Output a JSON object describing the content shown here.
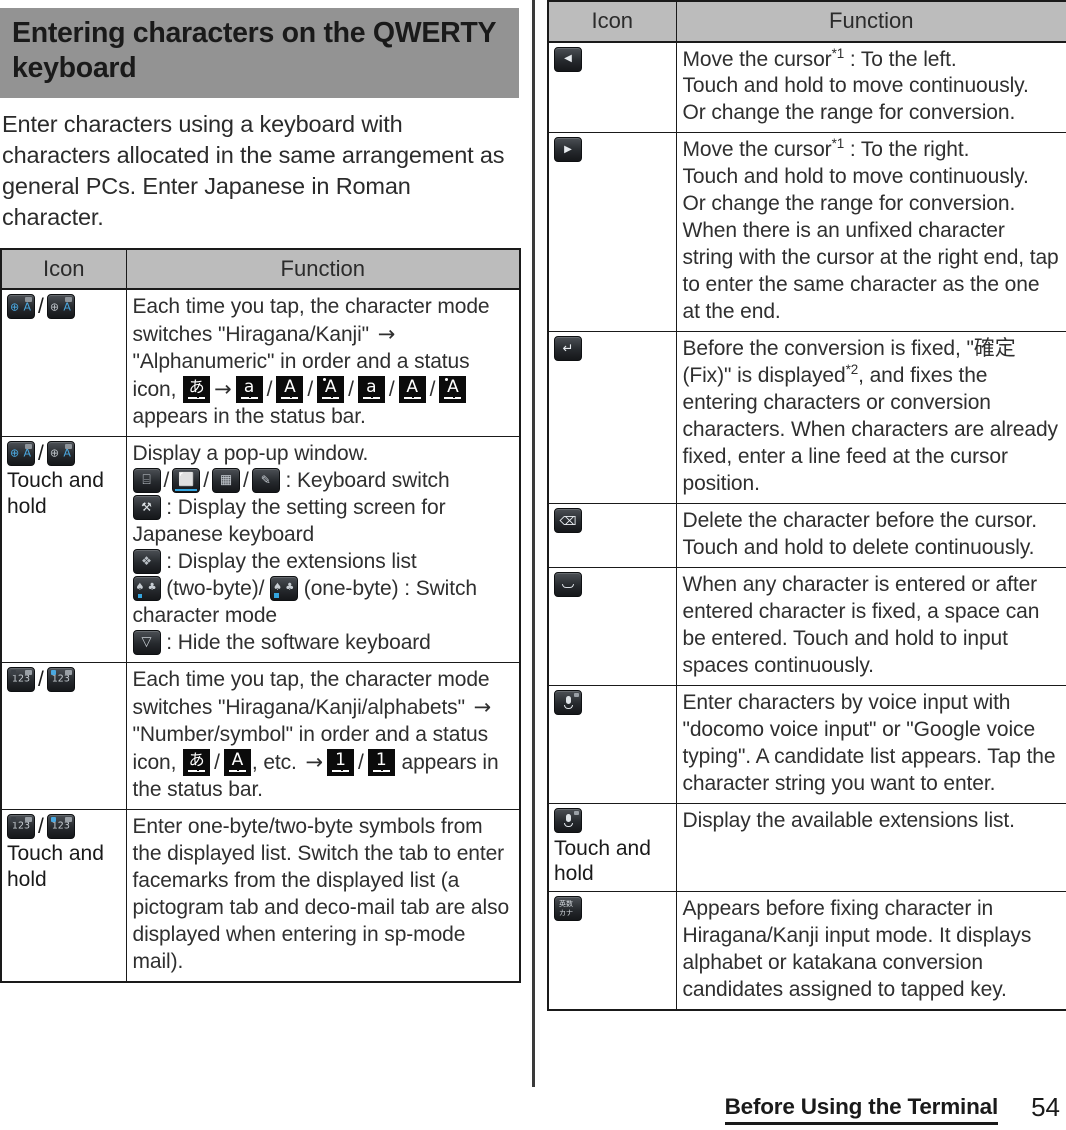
{
  "section": {
    "heading": "Entering characters on the QWERTY keyboard",
    "intro": "Enter characters using a keyboard with characters allocated in the same arrangement as general PCs. Enter Japanese in Roman character."
  },
  "table_left": {
    "headers": {
      "icon": "Icon",
      "function": "Function"
    },
    "rows": [
      {
        "icon_glyphs": [
          "keyboard-switch-globe-a-blue",
          "keyboard-switch-globe-a-gray"
        ],
        "icon_note": "",
        "function_parts": [
          {
            "t": "text",
            "v": "Each time you tap, the character mode switches \"Hiragana/Kanji\" "
          },
          {
            "t": "arrow",
            "v": "→"
          },
          {
            "t": "text",
            "v": " \"Alphanumeric\" in order and a status icon, "
          },
          {
            "t": "sicon",
            "v": "あ"
          },
          {
            "t": "arrow",
            "v": "→"
          },
          {
            "t": "sicon",
            "v": "a"
          },
          {
            "t": "slash",
            "v": "/"
          },
          {
            "t": "sicon",
            "v": "A"
          },
          {
            "t": "slash",
            "v": "/"
          },
          {
            "t": "sicon-dot",
            "v": "A"
          },
          {
            "t": "slash",
            "v": "/"
          },
          {
            "t": "sicon",
            "v": "a"
          },
          {
            "t": "slash",
            "v": "/"
          },
          {
            "t": "sicon",
            "v": "A"
          },
          {
            "t": "slash",
            "v": "/"
          },
          {
            "t": "sicon-dot",
            "v": "A"
          },
          {
            "t": "text",
            "v": " appears in the status bar."
          }
        ]
      },
      {
        "icon_glyphs": [
          "keyboard-switch-globe-a-blue",
          "keyboard-switch-globe-a-gray"
        ],
        "icon_note": "Touch and hold",
        "function_parts": [
          {
            "t": "text",
            "v": "Display a pop-up window."
          },
          {
            "t": "br",
            "v": ""
          },
          {
            "t": "kicon",
            "v": "phone-keypad"
          },
          {
            "t": "slash",
            "v": "/"
          },
          {
            "t": "kicon",
            "v": "qwerty-keyboard"
          },
          {
            "t": "slash",
            "v": "/"
          },
          {
            "t": "kicon",
            "v": "grid-keyboard"
          },
          {
            "t": "slash",
            "v": "/"
          },
          {
            "t": "kicon",
            "v": "handwriting"
          },
          {
            "t": "text",
            "v": " : Keyboard switch"
          },
          {
            "t": "br",
            "v": ""
          },
          {
            "t": "kicon",
            "v": "tools"
          },
          {
            "t": "text",
            "v": " : Display the setting screen for Japanese keyboard"
          },
          {
            "t": "br",
            "v": ""
          },
          {
            "t": "kicon",
            "v": "puzzle"
          },
          {
            "t": "text",
            "v": " : Display the extensions list"
          },
          {
            "t": "br",
            "v": ""
          },
          {
            "t": "kicon",
            "v": "two-byte"
          },
          {
            "t": "text",
            "v": " (two-byte)/ "
          },
          {
            "t": "kicon",
            "v": "one-byte"
          },
          {
            "t": "text",
            "v": " (one-byte) : Switch character mode"
          },
          {
            "t": "br",
            "v": ""
          },
          {
            "t": "kicon",
            "v": "hide-keyboard"
          },
          {
            "t": "text",
            "v": " : Hide the software keyboard"
          }
        ]
      },
      {
        "icon_glyphs": [
          "number-symbol-gray",
          "number-symbol-blue"
        ],
        "icon_note": "",
        "function_parts": [
          {
            "t": "text",
            "v": "Each time you tap, the character mode switches \"Hiragana/Kanji/alphabets\" "
          },
          {
            "t": "arrow",
            "v": "→"
          },
          {
            "t": "text",
            "v": " \"Number/symbol\" in order and a status icon, "
          },
          {
            "t": "sicon",
            "v": "あ"
          },
          {
            "t": "slash",
            "v": "/"
          },
          {
            "t": "sicon",
            "v": "A"
          },
          {
            "t": "text",
            "v": ", etc. "
          },
          {
            "t": "arrow",
            "v": "→"
          },
          {
            "t": "sicon",
            "v": "1"
          },
          {
            "t": "slash",
            "v": "/"
          },
          {
            "t": "sicon",
            "v": "1"
          },
          {
            "t": "text",
            "v": " appears in the status bar."
          }
        ]
      },
      {
        "icon_glyphs": [
          "number-symbol-gray",
          "number-symbol-blue"
        ],
        "icon_note": "Touch and hold",
        "function_parts": [
          {
            "t": "text",
            "v": "Enter one-byte/two-byte symbols from the displayed list. Switch the tab to enter facemarks from the displayed list (a pictogram tab and deco-mail tab are also displayed when entering in sp-mode mail)."
          }
        ]
      }
    ]
  },
  "table_right": {
    "headers": {
      "icon": "Icon",
      "function": "Function"
    },
    "rows": [
      {
        "icon_glyphs": [
          "cursor-left-arrow"
        ],
        "icon_note": "",
        "function_parts": [
          {
            "t": "text",
            "v": "Move the cursor"
          },
          {
            "t": "sup",
            "v": "*1"
          },
          {
            "t": "text",
            "v": " : To the left."
          },
          {
            "t": "br",
            "v": ""
          },
          {
            "t": "text",
            "v": "Touch and hold to move continuously."
          },
          {
            "t": "br",
            "v": ""
          },
          {
            "t": "text",
            "v": "Or change the range for conversion."
          }
        ]
      },
      {
        "icon_glyphs": [
          "cursor-right-arrow"
        ],
        "icon_note": "",
        "function_parts": [
          {
            "t": "text",
            "v": "Move the cursor"
          },
          {
            "t": "sup",
            "v": "*1"
          },
          {
            "t": "text",
            "v": " : To the right."
          },
          {
            "t": "br",
            "v": ""
          },
          {
            "t": "text",
            "v": "Touch and hold to move continuously."
          },
          {
            "t": "br",
            "v": ""
          },
          {
            "t": "text",
            "v": "Or change the range for conversion."
          },
          {
            "t": "br",
            "v": ""
          },
          {
            "t": "text",
            "v": "When there is an unfixed character string with the cursor at the right end, tap to enter the same character as the one at the end."
          }
        ]
      },
      {
        "icon_glyphs": [
          "enter-return-arrow"
        ],
        "icon_note": "",
        "function_parts": [
          {
            "t": "text",
            "v": "Before the conversion is fixed, \"確定 (Fix)\" is displayed"
          },
          {
            "t": "sup",
            "v": "*2"
          },
          {
            "t": "text",
            "v": ", and fixes the entering characters or conversion characters. When characters are already fixed, enter a line feed at the cursor position."
          }
        ]
      },
      {
        "icon_glyphs": [
          "backspace-delete"
        ],
        "icon_note": "",
        "function_parts": [
          {
            "t": "text",
            "v": "Delete the character before the cursor. Touch and hold to delete continuously."
          }
        ]
      },
      {
        "icon_glyphs": [
          "space-bar"
        ],
        "icon_note": "",
        "function_parts": [
          {
            "t": "text",
            "v": "When any character is entered or after entered character is fixed, a space can be entered. Touch and hold to input spaces continuously."
          }
        ]
      },
      {
        "icon_glyphs": [
          "microphone-voice"
        ],
        "icon_note": "",
        "function_parts": [
          {
            "t": "text",
            "v": "Enter characters by voice input with \"docomo voice input\" or \"Google voice typing\". A candidate list appears. Tap the character string you want to enter."
          }
        ]
      },
      {
        "icon_glyphs": [
          "microphone-voice"
        ],
        "icon_note": "Touch and hold",
        "function_parts": [
          {
            "t": "text",
            "v": "Display the available extensions list."
          }
        ]
      },
      {
        "icon_glyphs": [
          "katakana-conversion"
        ],
        "icon_note": "",
        "function_parts": [
          {
            "t": "text",
            "v": "Appears before fixing character in Hiragana/Kanji input mode. It displays alphabet or katakana conversion candidates assigned to tapped key."
          }
        ]
      }
    ]
  },
  "footer": {
    "chapter": "Before Using the Terminal",
    "page_number": "54"
  },
  "colors": {
    "banner_bg": "#939393",
    "table_header_bg": "#bcbcbc",
    "border": "#1a1a1a",
    "text": "#2b2b2b",
    "accent_blue": "#4aa8e0"
  }
}
